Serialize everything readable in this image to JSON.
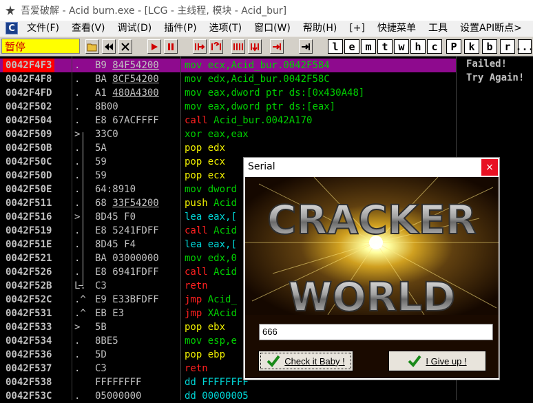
{
  "window": {
    "title": "吾爱破解 - Acid burn.exe - [LCG - 主线程, 模块 - Acid_bur]"
  },
  "menu": [
    "文件(F)",
    "查看(V)",
    "调试(D)",
    "插件(P)",
    "选项(T)",
    "窗口(W)",
    "帮助(H)",
    "[+]",
    "快捷菜单",
    "工具",
    "设置API断点>"
  ],
  "toolbar": {
    "status": "暂停",
    "letters": [
      "l",
      "e",
      "m",
      "t",
      "w",
      "h",
      "c",
      "P",
      "k",
      "b",
      "r",
      "..."
    ]
  },
  "disasm": [
    {
      "addr": "0042F4F3",
      "mark": ".",
      "hex_pre": "B9 ",
      "hex_u": "84F54200",
      "mn": "mov",
      "cls": "c-mov",
      "op": "ecx,Acid_bur.0042F584",
      "sel": true
    },
    {
      "addr": "0042F4F8",
      "mark": ".",
      "hex_pre": "BA ",
      "hex_u": "8CF54200",
      "mn": "mov",
      "cls": "c-mov",
      "op": "edx,Acid_bur.0042F58C"
    },
    {
      "addr": "0042F4FD",
      "mark": ".",
      "hex_pre": "A1 ",
      "hex_u": "480A4300",
      "mn": "mov",
      "cls": "c-mov",
      "op": "eax,dword ptr ds:[0x430A48]"
    },
    {
      "addr": "0042F502",
      "mark": ".",
      "hex_pre": "8B00",
      "hex_u": "",
      "mn": "mov",
      "cls": "c-mov",
      "op": "eax,dword ptr ds:[eax]"
    },
    {
      "addr": "0042F504",
      "mark": ".",
      "hex_pre": "E8 67ACFFFF",
      "hex_u": "",
      "mn": "call",
      "cls": "c-call",
      "op": "Acid_bur.0042A170"
    },
    {
      "addr": "0042F509",
      "mark": ">",
      "hex_pre": "33C0",
      "hex_u": "",
      "mn": "xor",
      "cls": "c-xor",
      "op": "eax,eax"
    },
    {
      "addr": "0042F50B",
      "mark": ".",
      "hex_pre": "5A",
      "hex_u": "",
      "mn": "pop",
      "cls": "c-pop",
      "op": "edx"
    },
    {
      "addr": "0042F50C",
      "mark": ".",
      "hex_pre": "59",
      "hex_u": "",
      "mn": "pop",
      "cls": "c-pop",
      "op": "ecx"
    },
    {
      "addr": "0042F50D",
      "mark": ".",
      "hex_pre": "59",
      "hex_u": "",
      "mn": "pop",
      "cls": "c-pop",
      "op": "ecx"
    },
    {
      "addr": "0042F50E",
      "mark": ".",
      "hex_pre": "64:8910",
      "hex_u": "",
      "mn": "mov",
      "cls": "c-mov",
      "op": "dword"
    },
    {
      "addr": "0042F511",
      "mark": ".",
      "hex_pre": "68 ",
      "hex_u": "33F54200",
      "mn": "push",
      "cls": "c-push",
      "op": "Acid"
    },
    {
      "addr": "0042F516",
      "mark": ">",
      "hex_pre": "8D45 F0",
      "hex_u": "",
      "mn": "lea",
      "cls": "c-lea",
      "op": "eax,["
    },
    {
      "addr": "0042F519",
      "mark": ".",
      "hex_pre": "E8 5241FDFF",
      "hex_u": "",
      "mn": "call",
      "cls": "c-call",
      "op": "Acid"
    },
    {
      "addr": "0042F51E",
      "mark": ".",
      "hex_pre": "8D45 F4",
      "hex_u": "",
      "mn": "lea",
      "cls": "c-lea",
      "op": "eax,["
    },
    {
      "addr": "0042F521",
      "mark": ".",
      "hex_pre": "BA 03000000",
      "hex_u": "",
      "mn": "mov",
      "cls": "c-mov",
      "op": "edx,0"
    },
    {
      "addr": "0042F526",
      "mark": ".",
      "hex_pre": "E8 6941FDFF",
      "hex_u": "",
      "mn": "call",
      "cls": "c-call",
      "op": "Acid"
    },
    {
      "addr": "0042F52B",
      "mark": "L.",
      "hex_pre": "C3",
      "hex_u": "",
      "mn": "retn",
      "cls": "c-retn",
      "op": ""
    },
    {
      "addr": "0042F52C",
      "mark": ".^",
      "hex_pre": "E9 E33BFDFF",
      "hex_u": "",
      "mn": "jmp",
      "cls": "c-jmp",
      "op": "Acid_"
    },
    {
      "addr": "0042F531",
      "mark": ".^",
      "hex_pre": "EB E3",
      "hex_u": "",
      "mn": "jmp",
      "cls": "c-jmp",
      "op": "XAcid"
    },
    {
      "addr": "0042F533",
      "mark": ">",
      "hex_pre": "5B",
      "hex_u": "",
      "mn": "pop",
      "cls": "c-pop",
      "op": "ebx"
    },
    {
      "addr": "0042F534",
      "mark": ".",
      "hex_pre": "8BE5",
      "hex_u": "",
      "mn": "mov",
      "cls": "c-mov",
      "op": "esp,e"
    },
    {
      "addr": "0042F536",
      "mark": ".",
      "hex_pre": "5D",
      "hex_u": "",
      "mn": "pop",
      "cls": "c-pop",
      "op": "ebp"
    },
    {
      "addr": "0042F537",
      "mark": ".",
      "hex_pre": "C3",
      "hex_u": "",
      "mn": "retn",
      "cls": "c-retn",
      "op": ""
    },
    {
      "addr": "0042F538",
      "mark": "",
      "hex_pre": "FFFFFFFF",
      "hex_u": "",
      "mn": "dd",
      "cls": "c-dd",
      "op": "FFFFFFFF"
    },
    {
      "addr": "0042F53C",
      "mark": ".",
      "hex_pre": "05000000",
      "hex_u": "",
      "mn": "dd",
      "cls": "c-dd",
      "op": "00000005"
    }
  ],
  "comments": {
    "line1": "Failed!",
    "line2": "Try Again!"
  },
  "dialog": {
    "title": "Serial",
    "close": "×",
    "logo_line1": "CRACKER",
    "logo_line2": "WORLD",
    "serial_value": "666",
    "check_label": "Check it Baby !",
    "give_label": "I Give up !"
  }
}
